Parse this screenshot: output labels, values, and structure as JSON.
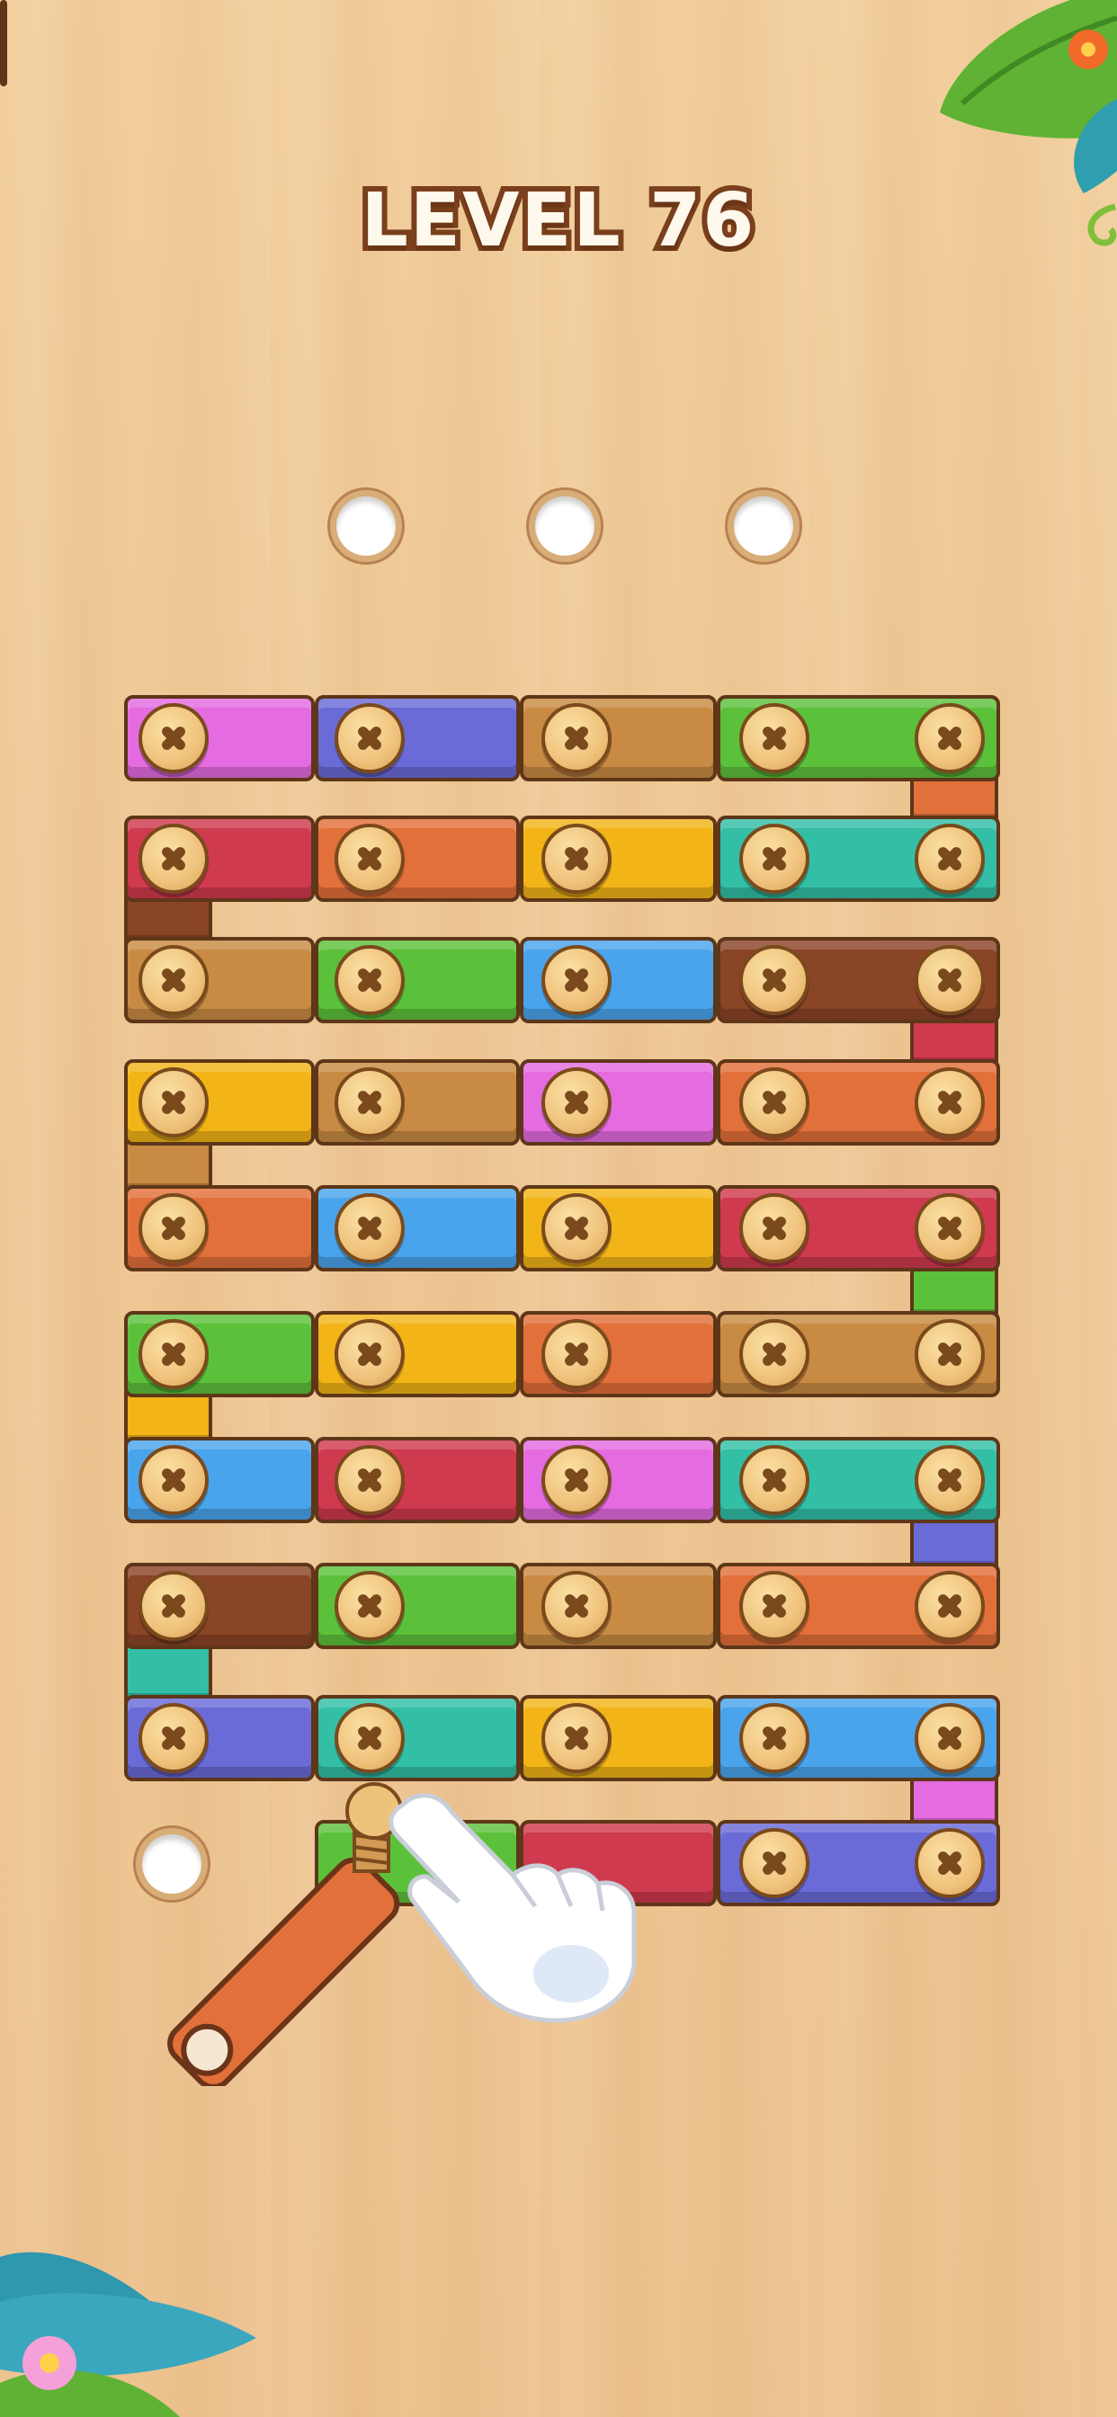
{
  "hud": {
    "level_label": "LEVEL 76"
  },
  "colors": {
    "pink": "#e56be0",
    "purple": "#6b6bd8",
    "tan": "#c98a43",
    "green": "#5cc13a",
    "red": "#cf3a4e",
    "orange": "#e2703a",
    "yellow": "#f2b417",
    "teal": "#33bfa6",
    "blue": "#4aa4ec",
    "brown": "#8a4426",
    "wood_tan": "#c4834a"
  },
  "rows": [
    {
      "cells": [
        "pink",
        "purple",
        "tan",
        "green"
      ]
    },
    {
      "cells": [
        "red",
        "orange",
        "yellow",
        "teal"
      ]
    },
    {
      "cells": [
        "tan",
        "green",
        "blue",
        "brown"
      ]
    },
    {
      "cells": [
        "yellow",
        "tan",
        "pink",
        "orange"
      ]
    },
    {
      "cells": [
        "orange",
        "blue",
        "yellow",
        "red"
      ]
    },
    {
      "cells": [
        "green",
        "yellow",
        "orange",
        "tan"
      ]
    },
    {
      "cells": [
        "blue",
        "red",
        "pink",
        "teal"
      ]
    },
    {
      "cells": [
        "brown",
        "green",
        "tan",
        "orange"
      ]
    },
    {
      "cells": [
        "purple",
        "teal",
        "yellow",
        "blue"
      ]
    },
    {
      "cells": [
        "green",
        "red",
        "red",
        "purple"
      ]
    }
  ],
  "connectors": [
    "orange",
    "brown",
    "red",
    "tan",
    "green",
    "yellow",
    "purple",
    "teal",
    "pink"
  ],
  "empty_holes": 4,
  "hint": {
    "pointer": "hand-pointer-icon"
  },
  "decorations": [
    "leaf-top-right-icon",
    "flower-icon",
    "leaf-bottom-left-icon"
  ]
}
